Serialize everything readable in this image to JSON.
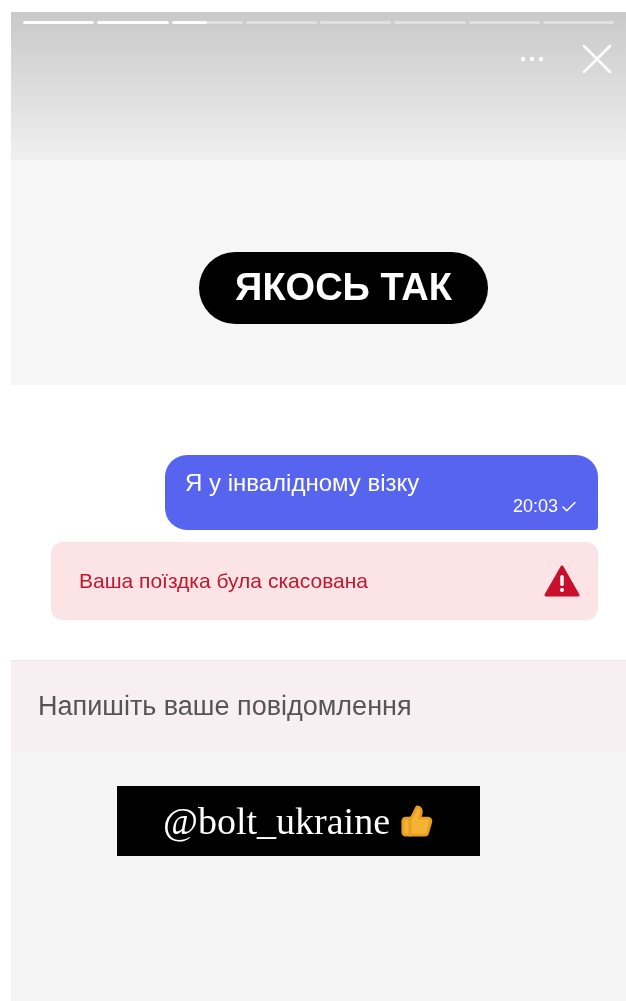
{
  "story_progress": [
    {
      "level": 1
    },
    {
      "level": 1
    },
    {
      "level": 0.5
    },
    {
      "level": 0
    },
    {
      "level": 0
    },
    {
      "level": 0
    },
    {
      "level": 0
    },
    {
      "level": 0
    }
  ],
  "caption": "ЯКОСЬ ТАК",
  "chat": {
    "message": {
      "text": "Я у інвалідному візку",
      "time": "20:03",
      "delivered": true
    },
    "alert": {
      "text": "Ваша поїздка була скасована"
    },
    "input": {
      "placeholder": "Напишіть ваше повідомлення"
    }
  },
  "mention": "@bolt_ukraine"
}
